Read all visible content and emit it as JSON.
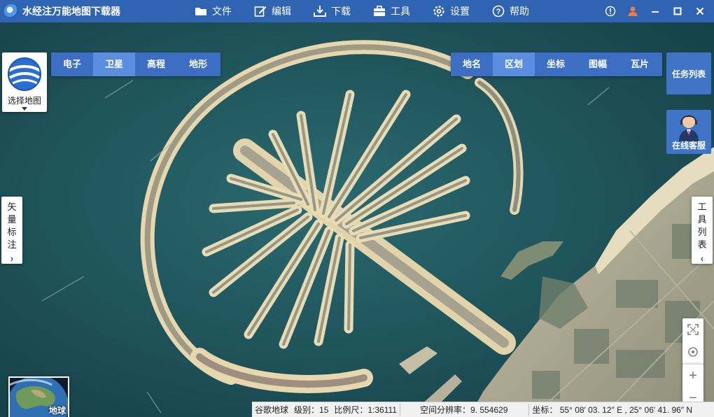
{
  "app": {
    "title": "水经注万能地图下载器"
  },
  "menu": [
    {
      "label": "文件",
      "icon": "folder-icon"
    },
    {
      "label": "编辑",
      "icon": "edit-icon"
    },
    {
      "label": "下载",
      "icon": "download-icon"
    },
    {
      "label": "工具",
      "icon": "toolbox-icon"
    },
    {
      "label": "设置",
      "icon": "gear-icon"
    },
    {
      "label": "帮助",
      "icon": "help-icon"
    }
  ],
  "map_select": {
    "label": "选择地图"
  },
  "map_tabs": [
    {
      "label": "电子",
      "active": false
    },
    {
      "label": "卫星",
      "active": true
    },
    {
      "label": "高程",
      "active": false
    },
    {
      "label": "地形",
      "active": false
    }
  ],
  "overlay_tabs": [
    {
      "label": "地名",
      "active": false
    },
    {
      "label": "区划",
      "active": true
    },
    {
      "label": "坐标",
      "active": false
    },
    {
      "label": "图幅",
      "active": false
    },
    {
      "label": "瓦片",
      "active": false
    }
  ],
  "task_list": {
    "label": "任务列表"
  },
  "online_service": {
    "label": "在线客服"
  },
  "left_panel": {
    "label": "矢量标注"
  },
  "right_panel": {
    "label": "工具列表"
  },
  "globe": {
    "label": "地球"
  },
  "status": {
    "source": "谷歌地球",
    "level": "级别：15",
    "scale": "比例尺：1:36111",
    "resolution": "空间分辨率：9. 554629",
    "coords": "坐标：  55° 08′ 03. 12″ E , 25° 06′ 41. 96″ N"
  },
  "colors": {
    "titlebar": "#2f64b3",
    "tab": "#3c6fc4",
    "tab_active": "#5a8ee0",
    "sea": "#1f5a63"
  }
}
